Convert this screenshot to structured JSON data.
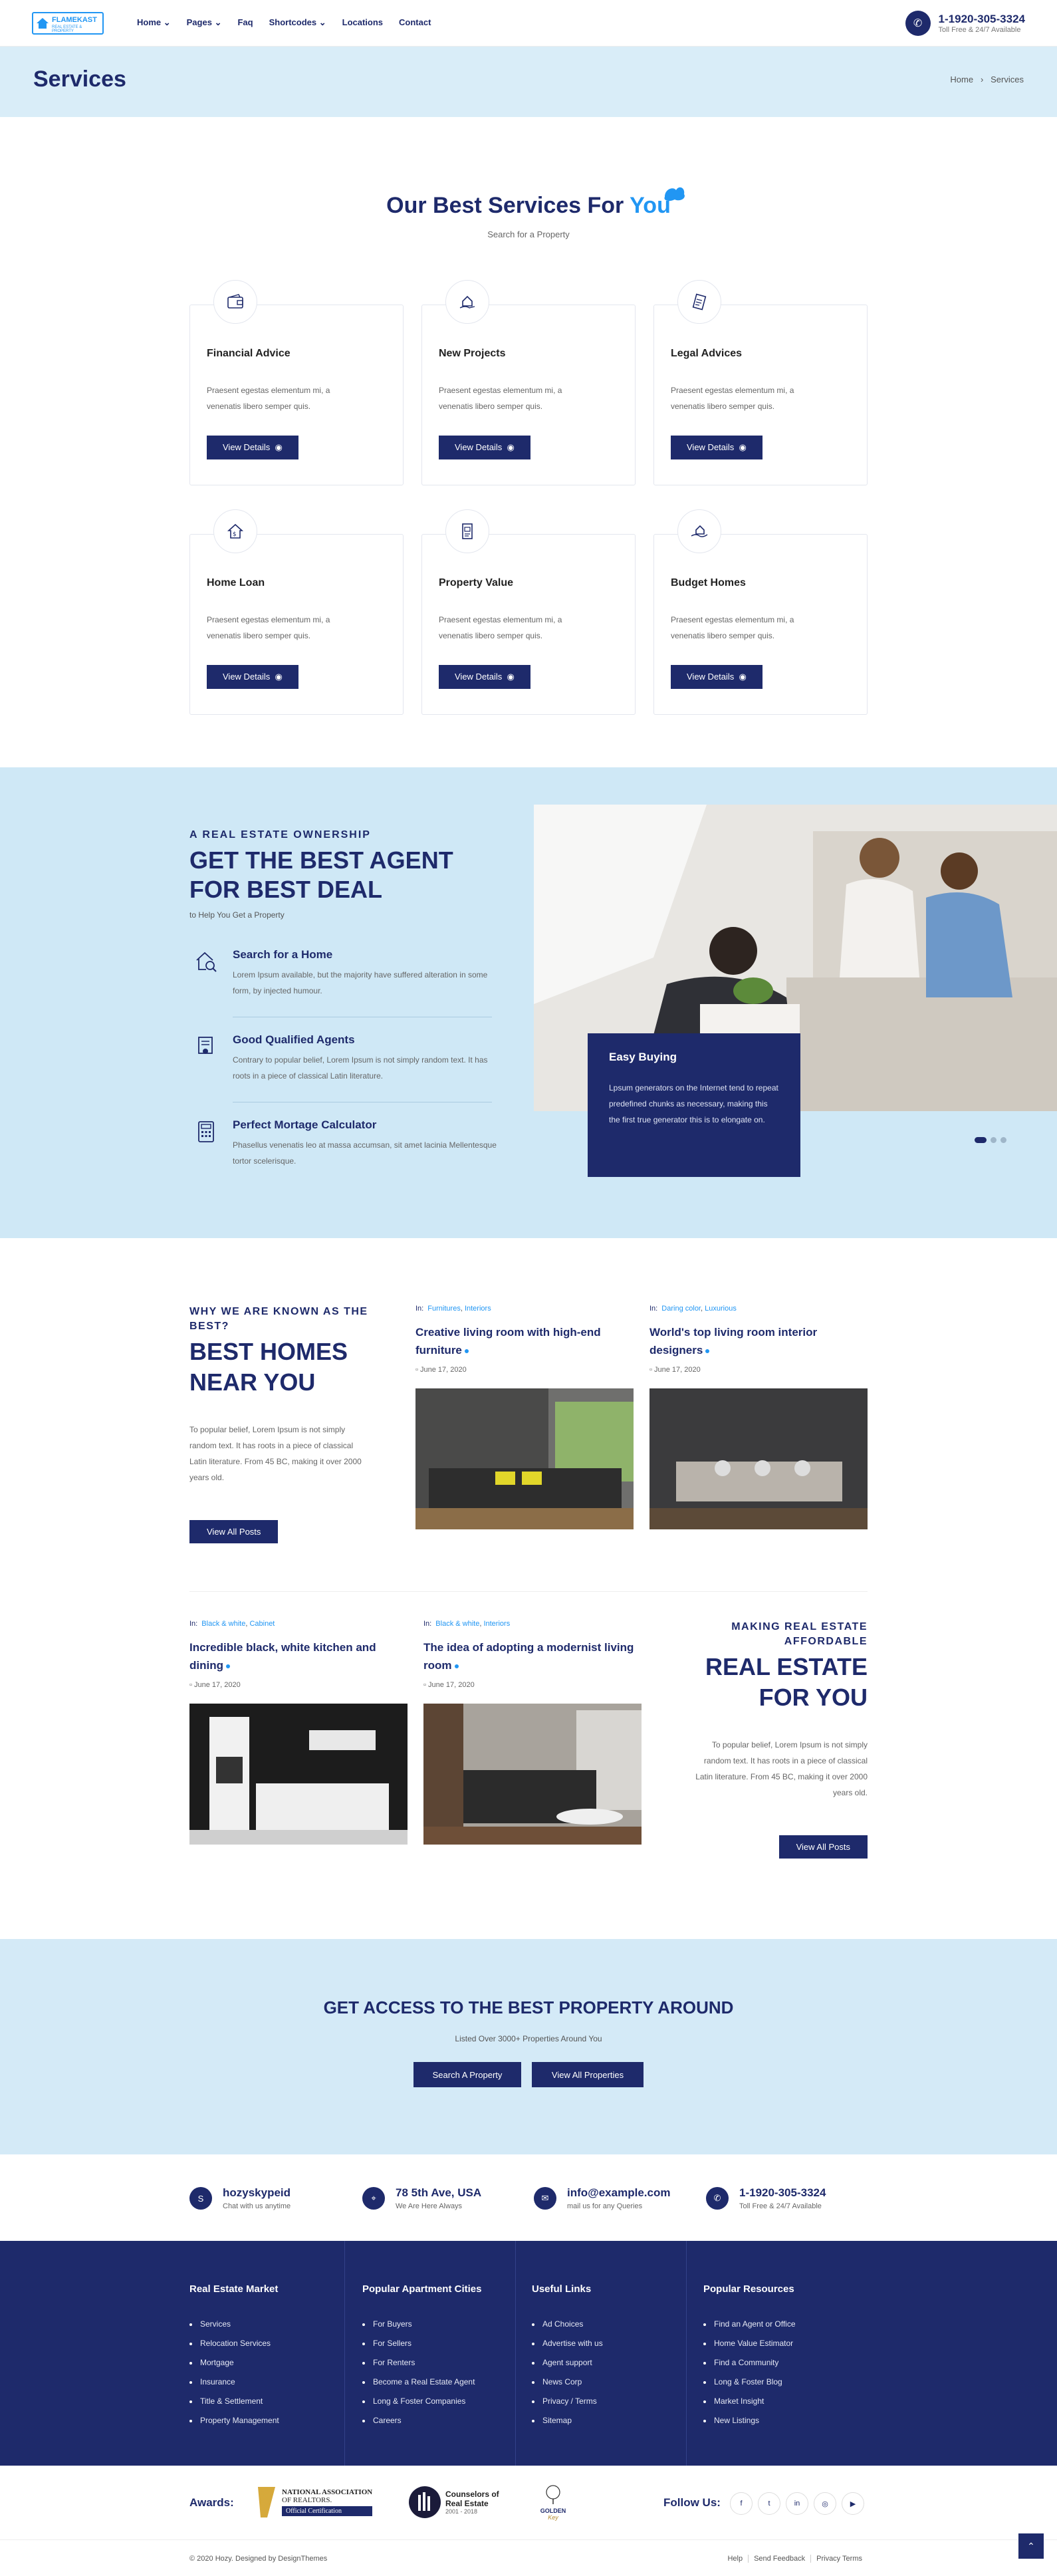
{
  "header": {
    "logo_name": "FLAMEKAST",
    "logo_tag": "REAL ESTATE & PROPERTY",
    "nav": [
      "Home",
      "Pages",
      "Faq",
      "Shortcodes",
      "Locations",
      "Contact"
    ],
    "phone": "1-1920-305-3324",
    "phone_sub": "Toll Free & 24/7 Available"
  },
  "title_bar": {
    "title": "Services",
    "breadcrumb_home": "Home",
    "breadcrumb_current": "Services"
  },
  "services": {
    "heading_main": "Our Best Services For",
    "heading_accent": "You",
    "subtitle": "Search for a Property",
    "cards": [
      {
        "icon": "wallet-icon",
        "title": "Financial Advice",
        "text": "Praesent egestas elementum mi, a venenatis libero semper quis.",
        "button": "View Details"
      },
      {
        "icon": "hand-house-icon",
        "title": "New Projects",
        "text": "Praesent egestas elementum mi, a venenatis libero semper quis.",
        "button": "View Details"
      },
      {
        "icon": "document-icon",
        "title": "Legal Advices",
        "text": "Praesent egestas elementum mi, a venenatis libero semper quis.",
        "button": "View Details"
      },
      {
        "icon": "house-dollar-icon",
        "title": "Home Loan",
        "text": "Praesent egestas elementum mi, a venenatis libero semper quis.",
        "button": "View Details"
      },
      {
        "icon": "building-doc-icon",
        "title": "Property Value",
        "text": "Praesent egestas elementum mi, a venenatis libero semper quis.",
        "button": "View Details"
      },
      {
        "icon": "hand-home-icon",
        "title": "Budget Homes",
        "text": "Praesent egestas elementum mi, a venenatis libero semper quis.",
        "button": "View Details"
      }
    ]
  },
  "agent": {
    "kicker": "A REAL ESTATE OWNERSHIP",
    "heading": "GET THE BEST AGENT FOR BEST DEAL",
    "sub": "to Help You Get a Property",
    "features": [
      {
        "icon": "search-house-icon",
        "title": "Search for a Home",
        "text": "Lorem Ipsum available, but the majority have suffered alteration in some form, by injected humour."
      },
      {
        "icon": "badge-doc-icon",
        "title": "Good Qualified Agents",
        "text": "Contrary to popular belief, Lorem Ipsum is not simply random text. It has roots in a piece of classical Latin literature."
      },
      {
        "icon": "calculator-icon",
        "title": "Perfect Mortage Calculator",
        "text": "Phasellus venenatis leo at massa accumsan, sit amet lacinia Mellentesque tortor scelerisque."
      }
    ],
    "box_title": "Easy Buying",
    "box_text": "Lpsum generators on the Internet tend to repeat predefined chunks as necessary, making this the first true generator this is to elongate on."
  },
  "blog": {
    "top_kicker": "WHY WE ARE KNOWN AS THE BEST?",
    "top_heading": "BEST HOMES NEAR YOU",
    "top_text": "To popular belief, Lorem Ipsum is not simply random text. It has roots in a piece of classical Latin literature. From 45 BC, making it over 2000 years old.",
    "top_button": "View All Posts",
    "bottom_kicker": "MAKING REAL ESTATE AFFORDABLE",
    "bottom_heading": "REAL ESTATE FOR YOU",
    "bottom_text": "To popular belief, Lorem Ipsum is not simply random text. It has roots in a piece of classical Latin literature. From 45 BC, making it over 2000 years old.",
    "bottom_button": "View All Posts",
    "in_label": "In:",
    "posts": [
      {
        "cat1": "Furnitures",
        "cat2": "Interiors",
        "title": "Creative living room with high-end furniture",
        "date": "June 17, 2020"
      },
      {
        "cat1": "Daring color",
        "cat2": "Luxurious",
        "title": "World's top living room interior designers",
        "date": "June 17, 2020"
      },
      {
        "cat1": "Black & white",
        "cat2": "Cabinet",
        "title": "Incredible black, white kitchen and dining",
        "date": "June 17, 2020"
      },
      {
        "cat1": "Black & white",
        "cat2": "Interiors",
        "title": "The idea of adopting a modernist living room",
        "date": "June 17, 2020"
      }
    ]
  },
  "cta": {
    "heading": "GET ACCESS TO THE BEST PROPERTY AROUND",
    "sub": "Listed Over 3000+ Properties Around You",
    "btn1": "Search A Property",
    "btn2": "View All Properties"
  },
  "contact": [
    {
      "icon": "skype-icon",
      "title": "hozyskypeid",
      "sub": "Chat with us anytime"
    },
    {
      "icon": "location-icon",
      "title": "78 5th Ave, USA",
      "sub": "We Are Here Always"
    },
    {
      "icon": "mail-icon",
      "title": "info@example.com",
      "sub": "mail us for any Queries"
    },
    {
      "icon": "phone-icon",
      "title": "1-1920-305-3324",
      "sub": "Toll Free & 24/7 Available"
    }
  ],
  "footer": {
    "cols": [
      {
        "title": "Real Estate Market",
        "items": [
          "Services",
          "Relocation Services",
          "Mortgage",
          "Insurance",
          "Title & Settlement",
          "Property Management"
        ]
      },
      {
        "title": "Popular Apartment Cities",
        "items": [
          "For Buyers",
          "For Sellers",
          "For Renters",
          "Become a Real Estate Agent",
          "Long & Foster Companies",
          "Careers"
        ]
      },
      {
        "title": "Useful Links",
        "items": [
          "Ad Choices",
          "Advertise with us",
          "Agent support",
          "News Corp",
          "Privacy / Terms",
          "Sitemap"
        ]
      },
      {
        "title": "Popular Resources",
        "items": [
          "Find an Agent or Office",
          "Home Value Estimator",
          "Find a Community",
          "Long & Foster Blog",
          "Market Insight",
          "New Listings"
        ]
      }
    ]
  },
  "awards": {
    "label": "Awards:",
    "a1_line1": "NATIONAL ASSOCIATION",
    "a1_line2": "OF REALTORS.",
    "a1_line3": "Official Certification",
    "a2_line1": "Counselors of",
    "a2_line2": "Real Estate",
    "a2_line3": "2001 - 2018",
    "a3_line1": "GOLDEN",
    "a3_line2": "Key",
    "follow": "Follow Us:",
    "social": [
      {
        "icon": "facebook-icon",
        "glyph": "f"
      },
      {
        "icon": "twitter-icon",
        "glyph": "t"
      },
      {
        "icon": "linkedin-icon",
        "glyph": "in"
      },
      {
        "icon": "instagram-icon",
        "glyph": "◎"
      },
      {
        "icon": "youtube-icon",
        "glyph": "▶"
      }
    ]
  },
  "copyright": {
    "text": "© 2020 Hozy. Designed by DesignThemes",
    "links": [
      "Help",
      "Send Feedback",
      "Privacy Terms"
    ]
  }
}
